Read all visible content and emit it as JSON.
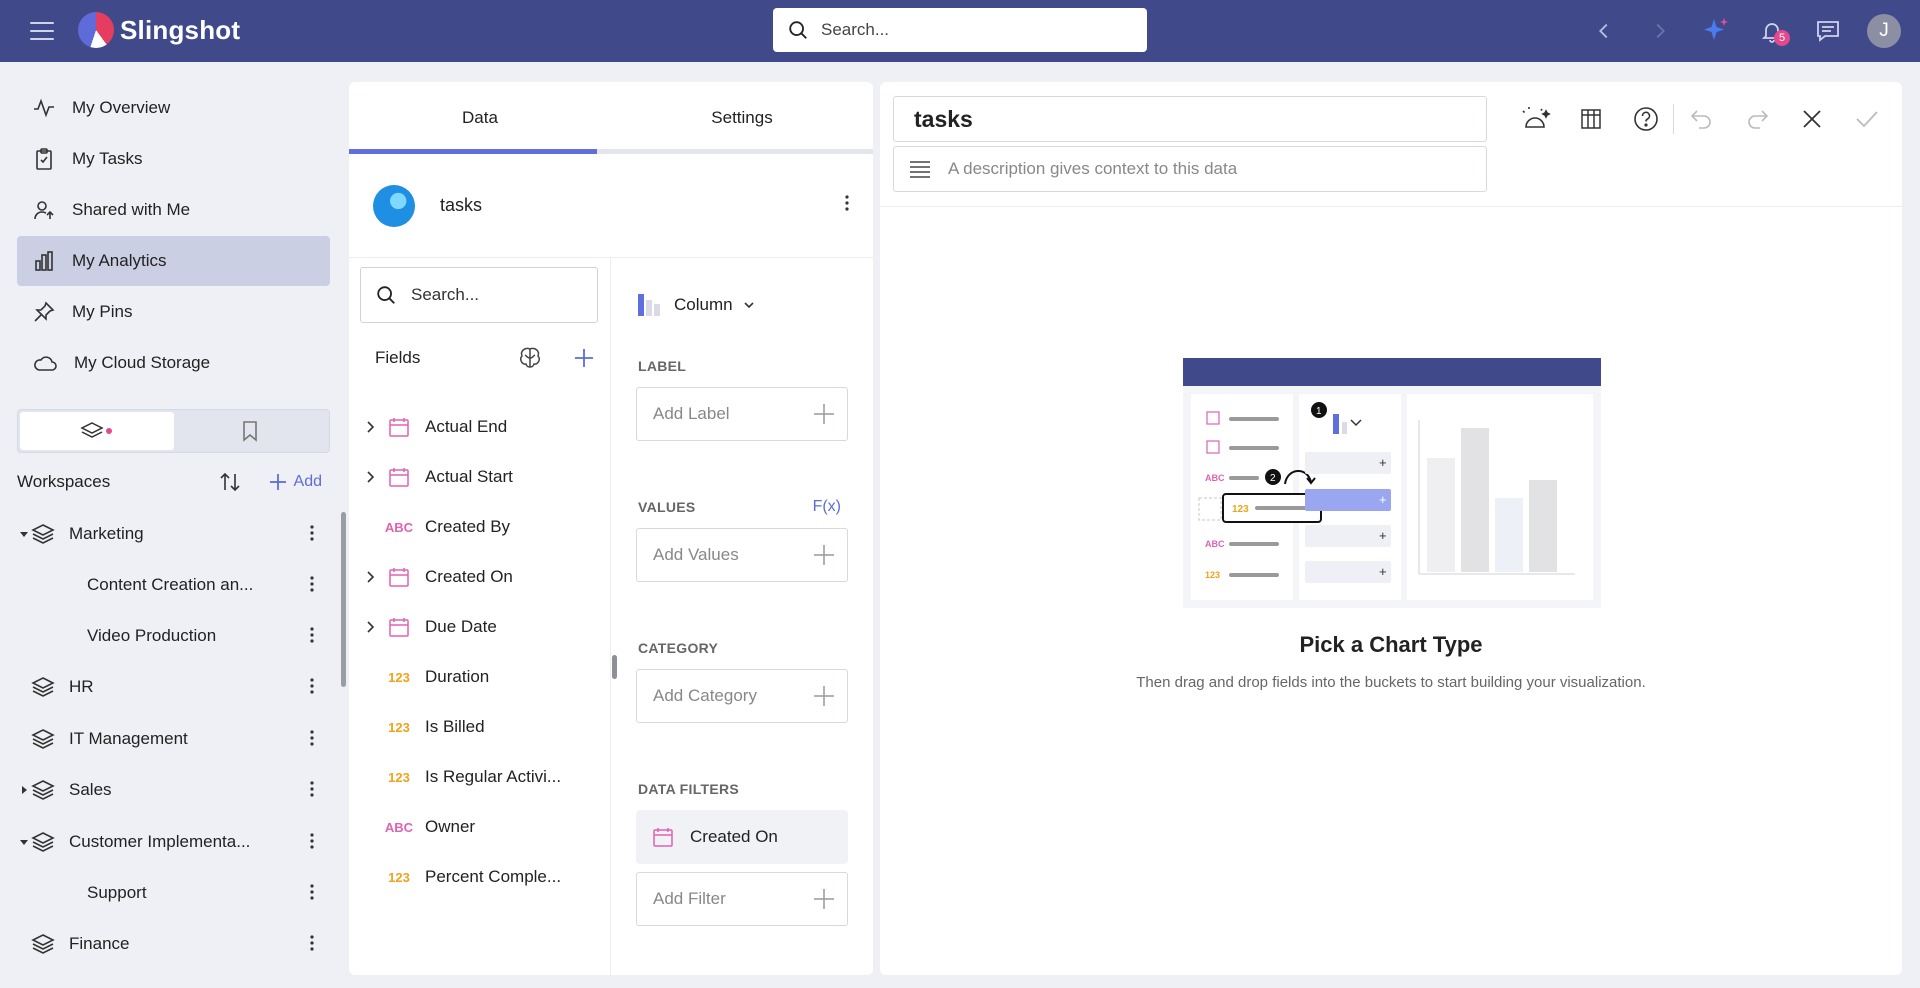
{
  "app": {
    "name": "Slingshot"
  },
  "topbar": {
    "search_placeholder": "Search...",
    "notification_count": "5",
    "avatar_initial": "J"
  },
  "sidebar": {
    "nav": [
      {
        "label": "My Overview",
        "icon": "activity-icon"
      },
      {
        "label": "My Tasks",
        "icon": "clipboard-check-icon"
      },
      {
        "label": "Shared with Me",
        "icon": "user-share-icon"
      },
      {
        "label": "My Analytics",
        "icon": "bar-chart-icon",
        "active": true
      },
      {
        "label": "My Pins",
        "icon": "pin-icon"
      },
      {
        "label": "My Cloud Storage",
        "icon": "cloud-icon"
      }
    ],
    "workspaces_title": "Workspaces",
    "add_label": "Add",
    "workspaces": [
      {
        "label": "Marketing",
        "level": 0,
        "expanded": true
      },
      {
        "label": "Content Creation an...",
        "level": 1
      },
      {
        "label": "Video Production",
        "level": 1
      },
      {
        "label": "HR",
        "level": 0
      },
      {
        "label": "IT Management",
        "level": 0
      },
      {
        "label": "Sales",
        "level": 0,
        "collapsed": true
      },
      {
        "label": "Customer Implementa...",
        "level": 0,
        "expanded": true
      },
      {
        "label": "Support",
        "level": 1
      },
      {
        "label": "Finance",
        "level": 0
      }
    ]
  },
  "data_panel": {
    "tabs": [
      "Data",
      "Settings"
    ],
    "active_tab": "Data",
    "datasource_name": "tasks",
    "search_placeholder": "Search...",
    "fields_label": "Fields",
    "fields": [
      {
        "label": "Actual End",
        "type": "date",
        "expandable": true
      },
      {
        "label": "Actual Start",
        "type": "date",
        "expandable": true
      },
      {
        "label": "Created By",
        "type": "ABC"
      },
      {
        "label": "Created On",
        "type": "date",
        "expandable": true
      },
      {
        "label": "Due Date",
        "type": "date",
        "expandable": true
      },
      {
        "label": "Duration",
        "type": "123"
      },
      {
        "label": "Is Billed",
        "type": "123"
      },
      {
        "label": "Is Regular Activi...",
        "type": "123"
      },
      {
        "label": "Owner",
        "type": "ABC"
      },
      {
        "label": "Percent Comple...",
        "type": "123"
      }
    ],
    "chart_type": "Column",
    "buckets": {
      "label_title": "LABEL",
      "label_placeholder": "Add Label",
      "values_title": "VALUES",
      "values_fx": "F(x)",
      "values_placeholder": "Add Values",
      "category_title": "CATEGORY",
      "category_placeholder": "Add Category",
      "filters_title": "DATA FILTERS",
      "filter_chip": "Created On",
      "filter_placeholder": "Add Filter"
    }
  },
  "canvas": {
    "title": "tasks",
    "description_placeholder": "A description gives context to this data",
    "pick_title": "Pick a Chart Type",
    "pick_subtitle": "Then drag and drop fields into the buckets to start building your visualization.",
    "illustration": {
      "step1": "1",
      "step2": "2",
      "abc": "ABC",
      "num": "123"
    }
  },
  "colors": {
    "header": "#404a8b",
    "accent": "#5f6fdb",
    "date_icon": "#e062b3",
    "number_icon": "#f2a21a"
  }
}
